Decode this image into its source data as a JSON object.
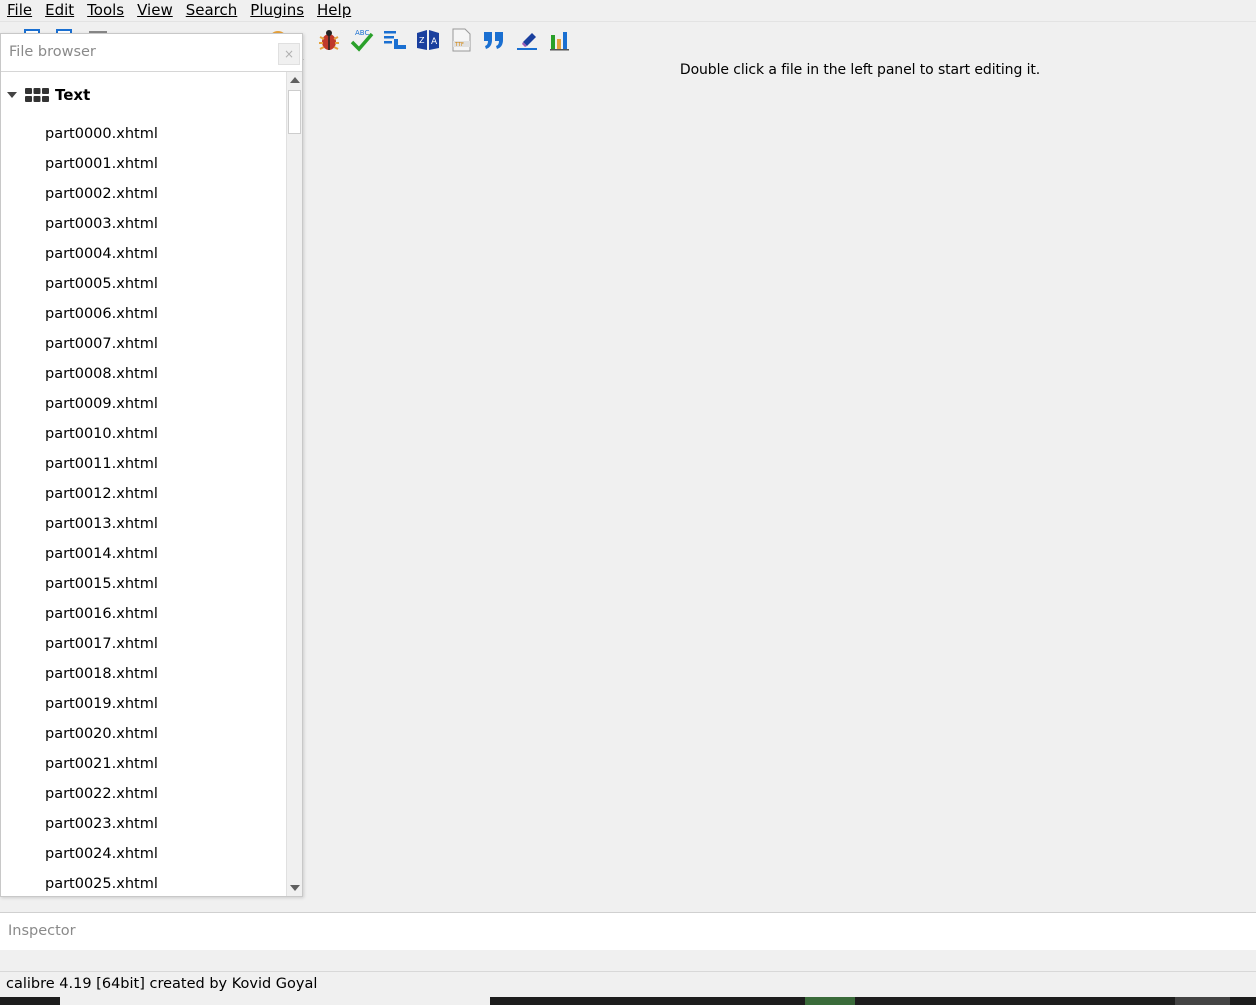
{
  "menu": [
    {
      "label": "File"
    },
    {
      "label": "Edit"
    },
    {
      "label": "Tools"
    },
    {
      "label": "View"
    },
    {
      "label": "Search"
    },
    {
      "label": "Plugins"
    },
    {
      "label": "Help"
    }
  ],
  "toolbar": {
    "icons": [
      "new-file-icon",
      "import-icon",
      "save-icon",
      "undo-icon",
      "redo-icon",
      "checkpoint-icon",
      "preferences-icon",
      "check-book-icon",
      "spellcheck-icon",
      "table-of-contents-icon",
      "reports-icon",
      "embedded-fonts-icon",
      "smarten-quotes-icon",
      "remove-styles-icon",
      "charts-icon"
    ]
  },
  "editor": {
    "empty_message": "Double click a file in the left panel to start editing it."
  },
  "file_browser": {
    "title": "File browser",
    "close_label": "×",
    "category": "Text",
    "files": [
      "part0000.xhtml",
      "part0001.xhtml",
      "part0002.xhtml",
      "part0003.xhtml",
      "part0004.xhtml",
      "part0005.xhtml",
      "part0006.xhtml",
      "part0007.xhtml",
      "part0008.xhtml",
      "part0009.xhtml",
      "part0010.xhtml",
      "part0011.xhtml",
      "part0012.xhtml",
      "part0013.xhtml",
      "part0014.xhtml",
      "part0015.xhtml",
      "part0016.xhtml",
      "part0017.xhtml",
      "part0018.xhtml",
      "part0019.xhtml",
      "part0020.xhtml",
      "part0021.xhtml",
      "part0022.xhtml",
      "part0023.xhtml",
      "part0024.xhtml",
      "part0025.xhtml"
    ]
  },
  "inspector": {
    "title": "Inspector"
  },
  "status": {
    "text": "calibre 4.19 [64bit] created by Kovid Goyal"
  },
  "colors": {
    "accent_blue": "#1a6fd1",
    "check_green": "#2aa02a",
    "bug_red": "#c0392b"
  }
}
